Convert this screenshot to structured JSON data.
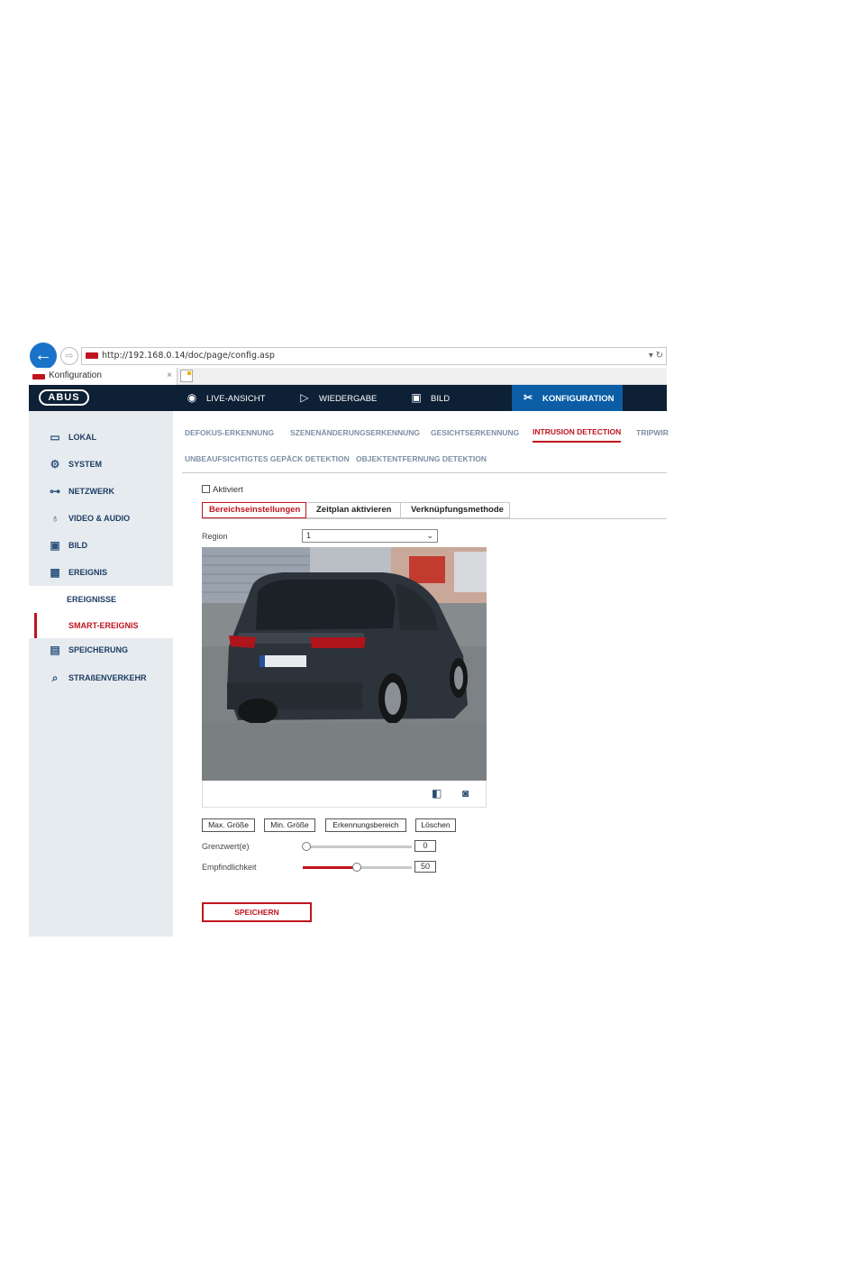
{
  "browser": {
    "url": "http://192.168.0.14/doc/page/config.asp",
    "tab_title": "Konfiguration",
    "tab_close": "×",
    "url_controls": "▾ ↻"
  },
  "header": {
    "logo": "ABUS",
    "nav": [
      {
        "label": "LIVE-ANSICHT",
        "icon": "eye-icon"
      },
      {
        "label": "WIEDERGABE",
        "icon": "play-icon"
      },
      {
        "label": "BILD",
        "icon": "image-icon"
      },
      {
        "label": "KONFIGURATION",
        "icon": "tools-icon",
        "active": true
      }
    ]
  },
  "sidebar": {
    "items": [
      {
        "label": "LOKAL",
        "icon": "monitor-icon"
      },
      {
        "label": "SYSTEM",
        "icon": "gear-icon"
      },
      {
        "label": "NETZWERK",
        "icon": "network-icon"
      },
      {
        "label": "VIDEO & AUDIO",
        "icon": "microphone-icon"
      },
      {
        "label": "BILD",
        "icon": "image-icon"
      },
      {
        "label": "EREIGNIS",
        "icon": "calendar-icon"
      },
      {
        "label": "EREIGNISSE",
        "sub": true
      },
      {
        "label": "SMART-EREIGNIS",
        "sub": true,
        "active": true
      },
      {
        "label": "SPEICHERUNG",
        "icon": "save-icon"
      },
      {
        "label": "STRAßENVERKEHR",
        "icon": "traffic-search-icon"
      }
    ]
  },
  "content": {
    "tabs_row1": [
      "DEFOKUS-ERKENNUNG",
      "SZENENÄNDERUNGSERKENNUNG",
      "GESICHTSERKENNUNG",
      "INTRUSION DETECTION",
      "TRIPWIR"
    ],
    "tabs_row2": [
      "UNBEAUFSICHTIGTES GEPÄCK DETEKTION",
      "OBJEKTENTFERNUNG DETEKTION"
    ],
    "active_tab": "INTRUSION DETECTION",
    "enabled_label": "Aktiviert",
    "enabled": false,
    "sub_tabs": [
      "Bereichseinstellungen",
      "Zeitplan aktivieren",
      "Verknüpfungsmethode"
    ],
    "region_label": "Region",
    "region_value": "1",
    "buttons": [
      "Max. Größe",
      "Min. Größe",
      "Erkennungsbereich",
      "Löschen"
    ],
    "threshold_label": "Grenzwert(e)",
    "threshold_value": "0",
    "sensitivity_label": "Empfindlichkeit",
    "sensitivity_value": "50",
    "save_label": "SPEICHERN"
  }
}
